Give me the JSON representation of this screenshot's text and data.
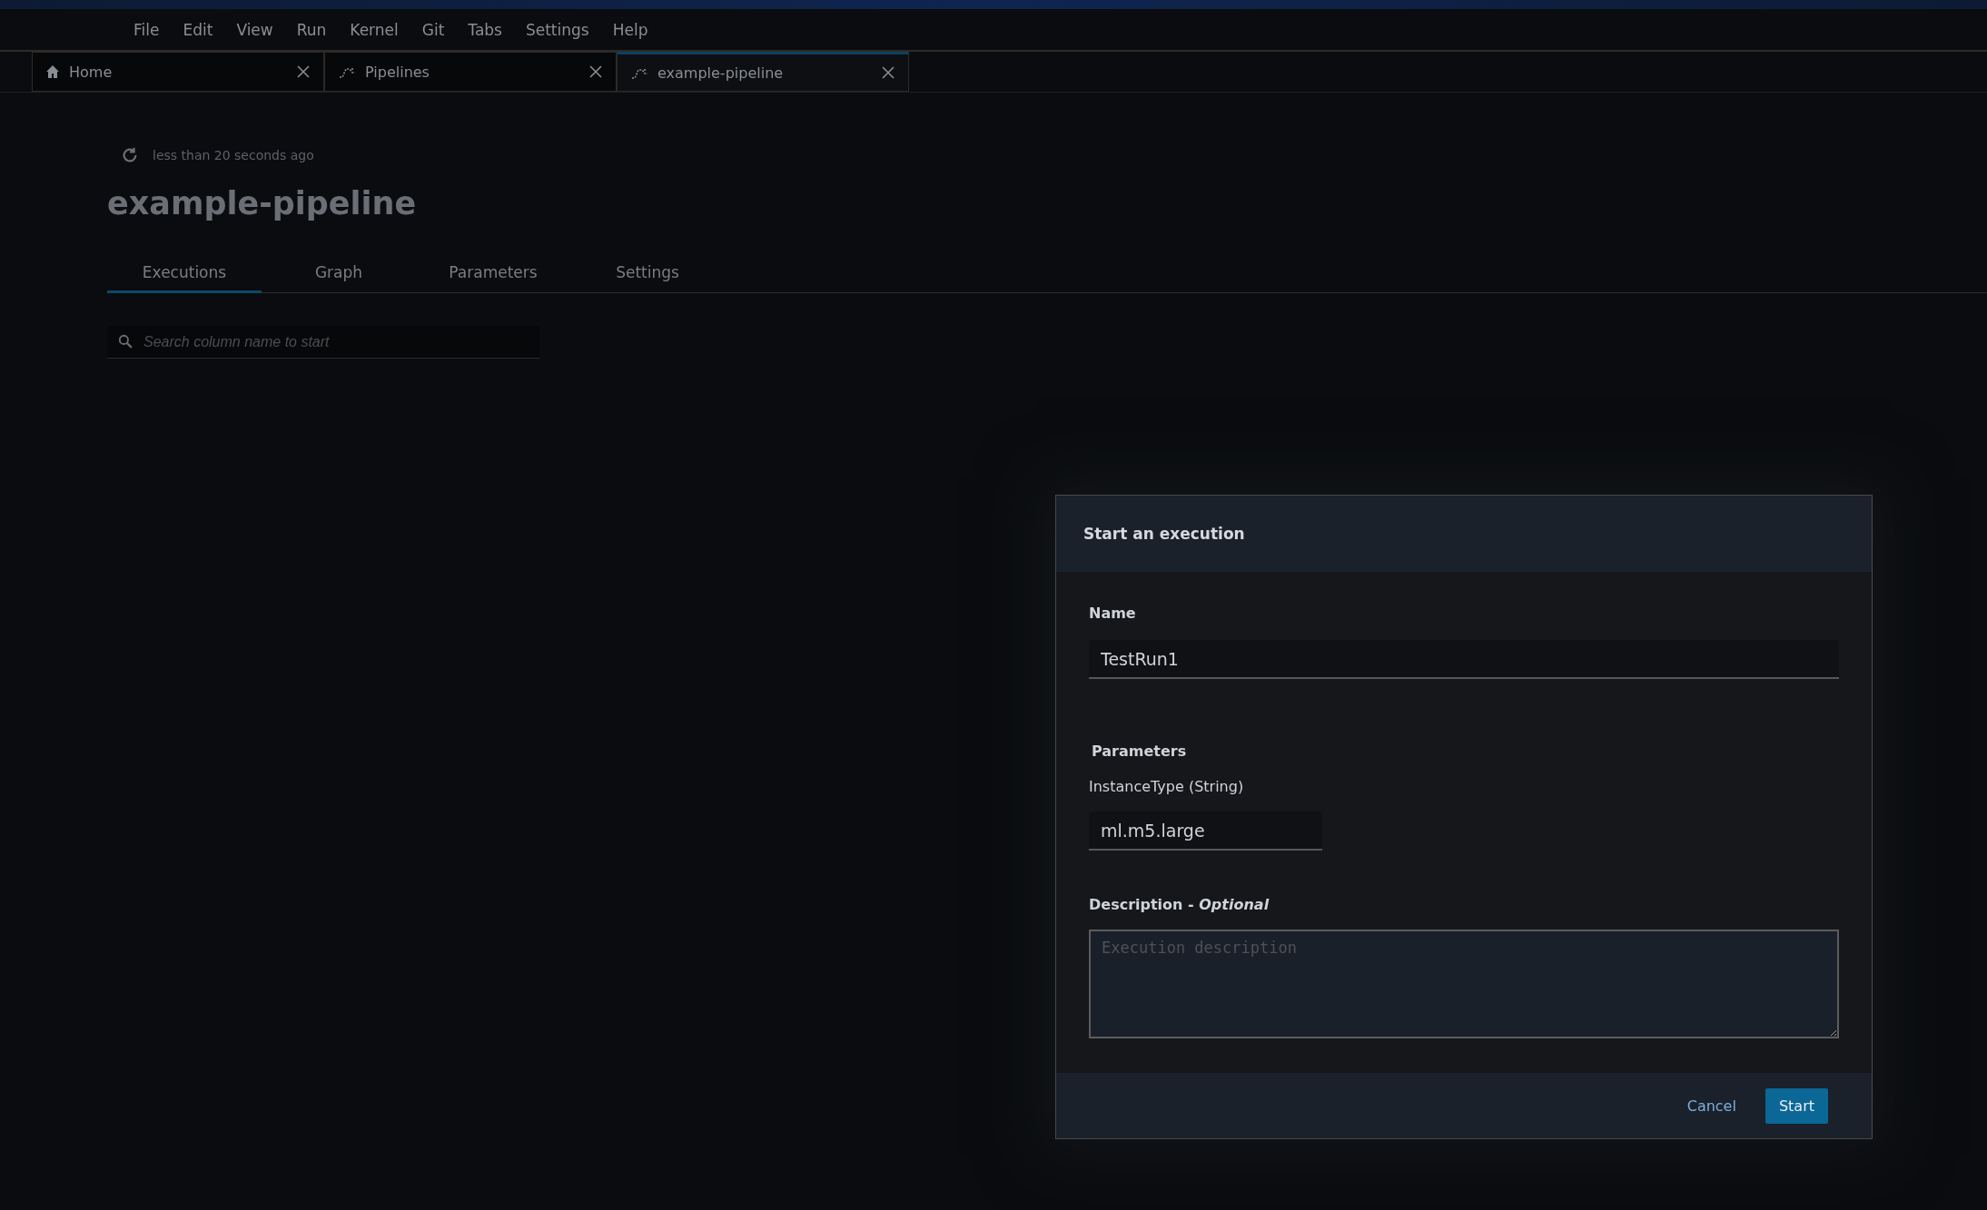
{
  "menu": [
    "File",
    "Edit",
    "View",
    "Run",
    "Kernel",
    "Git",
    "Tabs",
    "Settings",
    "Help"
  ],
  "tabs": [
    {
      "label": "Home",
      "kind": "home",
      "selected": false
    },
    {
      "label": "Pipelines",
      "kind": "pipeline",
      "selected": false
    },
    {
      "label": "example-pipeline",
      "kind": "pipeline",
      "selected": true
    }
  ],
  "refreshed": "less than 20 seconds ago",
  "title": "example-pipeline",
  "page_tabs": [
    {
      "label": "Executions",
      "selected": true
    },
    {
      "label": "Graph",
      "selected": false
    },
    {
      "label": "Parameters",
      "selected": false
    },
    {
      "label": "Settings",
      "selected": false
    }
  ],
  "search": {
    "placeholder": "Search column name to start"
  },
  "dialog": {
    "title": "Start an execution",
    "name_label": "Name",
    "name_value": "TestRun1",
    "parameters_heading": "Parameters",
    "parameters": [
      {
        "label": "InstanceType (String)",
        "value": "ml.m5.large"
      }
    ],
    "description_label": "Description - *Optional*",
    "description_placeholder": "Execution description",
    "buttons": [
      {
        "label": "Cancel",
        "kind": "link"
      },
      {
        "label": "Start",
        "kind": "primary"
      }
    ]
  }
}
